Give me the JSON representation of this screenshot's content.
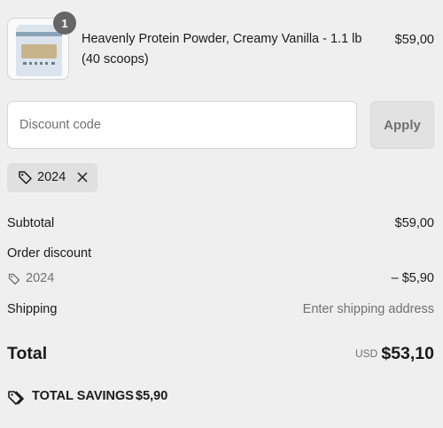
{
  "product": {
    "name": "Heavenly Protein Powder, Creamy Vanilla - 1.1 lb (40 scoops)",
    "price": "$59,00",
    "quantity": "1",
    "image_icon": "product-image"
  },
  "discount": {
    "placeholder": "Discount code",
    "value": "",
    "apply_label": "Apply",
    "applied_code": "2024",
    "tag_icon": "tag-icon",
    "remove_icon": "close-icon"
  },
  "summary": {
    "subtotal_label": "Subtotal",
    "subtotal_value": "$59,00",
    "order_discount_label": "Order discount",
    "order_discount_code": "2024",
    "order_discount_value": "– $5,90",
    "shipping_label": "Shipping",
    "shipping_value": "Enter shipping address"
  },
  "total": {
    "label": "Total",
    "currency": "USD",
    "value": "$53,10"
  },
  "savings": {
    "label": "TOTAL SAVINGS",
    "value": "$5,90",
    "icon": "tags-icon"
  },
  "colors": {
    "background": "#efefef",
    "muted_text": "#707070",
    "badge": "#666666"
  }
}
